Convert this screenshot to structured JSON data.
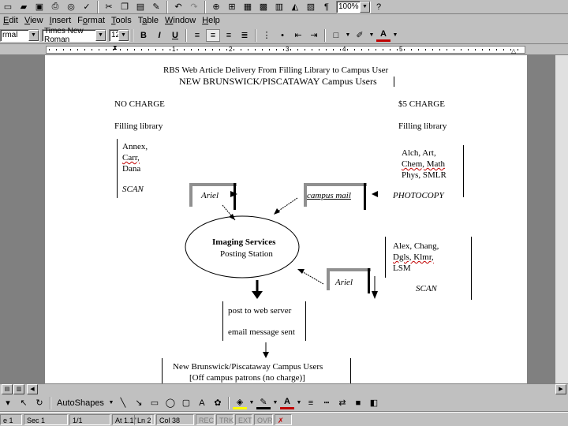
{
  "standard_toolbar": {
    "zoom_value": "100%"
  },
  "menu_bar": {
    "items": [
      {
        "label": "Edit",
        "key": "E"
      },
      {
        "label": "View",
        "key": "V"
      },
      {
        "label": "Insert",
        "key": "I"
      },
      {
        "label": "Format",
        "key": "o"
      },
      {
        "label": "Tools",
        "key": "T"
      },
      {
        "label": "Table",
        "key": "a"
      },
      {
        "label": "Window",
        "key": "W"
      },
      {
        "label": "Help",
        "key": "H"
      }
    ]
  },
  "formatting_toolbar": {
    "style_value": "rmal",
    "font_value": "Times New Roman",
    "size_value": "12",
    "bold_label": "B",
    "italic_label": "I",
    "underline_label": "U"
  },
  "ruler": {
    "numbers": [
      "1",
      "2",
      "3",
      "4",
      "5"
    ]
  },
  "document": {
    "title_line1": "RBS Web Article Delivery From Filling Library to Campus User",
    "title_line2": "NEW BRUNSWICK/PISCATAWAY Campus Users",
    "no_charge_heading": "NO CHARGE",
    "charge_heading": "$5 CHARGE",
    "left_filling_label": "Filling library",
    "right_filling_label": "Filling library",
    "left_libs": [
      "Annex,",
      "Carr,",
      "Dana"
    ],
    "left_action": "SCAN",
    "right_libs": [
      "Alch, Art,",
      "Chem, Math",
      "Phys, SMLR"
    ],
    "right_action": "PHOTOCOPY",
    "truck_ariel_1": "Ariel",
    "truck_campus_mail": "campus mail",
    "imaging_line1": "Imaging Services",
    "imaging_line2": "Posting Station",
    "lower_libs": [
      "Alex, Chang,",
      "Dgls, Klmr,",
      "LSM"
    ],
    "lower_action": "SCAN",
    "truck_ariel_2": "Ariel",
    "post_line": "post to web server",
    "email_line": "email message sent",
    "users_line1": "New Brunswick/Piscataway Campus Users",
    "users_line2": "[Off campus patrons (no charge)]"
  },
  "drawing_toolbar": {
    "autoshapes_label": "AutoShapes"
  },
  "status_bar": {
    "page": "e 1",
    "section": "Sec 1",
    "pages": "1/1",
    "at": "At 1.1\"",
    "line": "Ln 2",
    "col": "Col 38",
    "rec": "REC",
    "trk": "TRK",
    "ext": "EXT",
    "ovr": "OVR"
  }
}
